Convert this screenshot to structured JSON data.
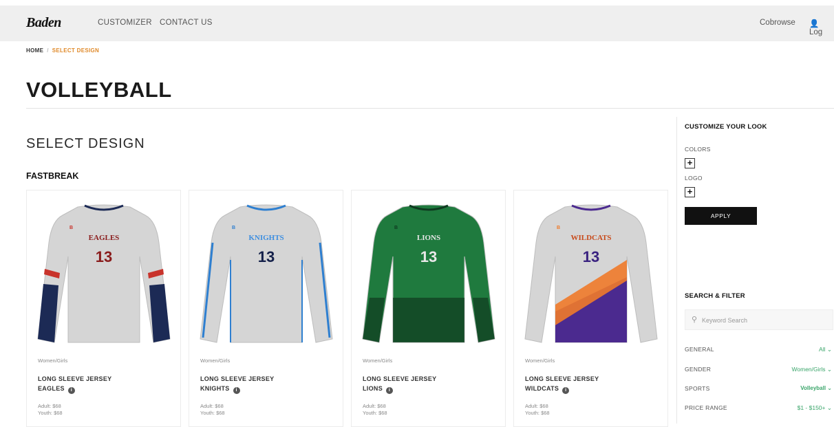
{
  "header": {
    "logo": "Baden",
    "nav": [
      "CUSTOMIZER",
      "CONTACT US"
    ],
    "cobrowse": "Cobrowse",
    "login": "Log"
  },
  "breadcrumb": {
    "home": "HOME",
    "current": "SELECT DESIGN"
  },
  "page_title": "VOLLEYBALL",
  "section_title": "SELECT DESIGN",
  "group_title": "FASTBREAK",
  "products": [
    {
      "category": "Women/Girls",
      "line1": "LONG SLEEVE JERSEY",
      "line2": "EAGLES",
      "adult": "Adult: $68",
      "youth": "Youth: $68",
      "jersey_text": "EAGLES",
      "number": "13",
      "body": "#d5d5d5",
      "accent": "#1c2a55",
      "stripe": "#c8332b",
      "text_color": "#8a1c1c",
      "num_color": "#8a1c1c"
    },
    {
      "category": "Women/Girls",
      "line1": "LONG SLEEVE JERSEY",
      "line2": "KNIGHTS",
      "adult": "Adult: $68",
      "youth": "Youth: $68",
      "jersey_text": "KNIGHTS",
      "number": "13",
      "body": "#d5d5d5",
      "accent": "#2e7fd0",
      "stripe": "#2e7fd0",
      "text_color": "#3d8ee0",
      "num_color": "#14204a"
    },
    {
      "category": "Women/Girls",
      "line1": "LONG SLEEVE JERSEY",
      "line2": "LIONS",
      "adult": "Adult: $68",
      "youth": "Youth: $68",
      "jersey_text": "LIONS",
      "number": "13",
      "body": "#1f7a3e",
      "accent": "#0f3a20",
      "stripe": "#0f3a20",
      "text_color": "#e8e8e8",
      "num_color": "#e8e8e8"
    },
    {
      "category": "Women/Girls",
      "line1": "LONG SLEEVE JERSEY",
      "line2": "WILDCATS",
      "adult": "Adult: $68",
      "youth": "Youth: $68",
      "jersey_text": "WILDCATS",
      "number": "13",
      "body": "#d5d5d5",
      "accent": "#4b2a8f",
      "stripe": "#f07a2a",
      "text_color": "#c84a1a",
      "num_color": "#3a2280"
    }
  ],
  "sidebar": {
    "customize_title": "CUSTOMIZE YOUR LOOK",
    "colors_label": "COLORS",
    "logo_label": "LOGO",
    "plus": "+",
    "apply": "APPLY",
    "filter_title": "SEARCH & FILTER",
    "search_placeholder": "Keyword Search",
    "filters": [
      {
        "label": "GENERAL",
        "value": "All"
      },
      {
        "label": "GENDER",
        "value": "Women/Girls"
      },
      {
        "label": "SPORTS",
        "value": "Volleyball"
      },
      {
        "label": "PRICE RANGE",
        "value": "$1 - $150+"
      }
    ]
  }
}
